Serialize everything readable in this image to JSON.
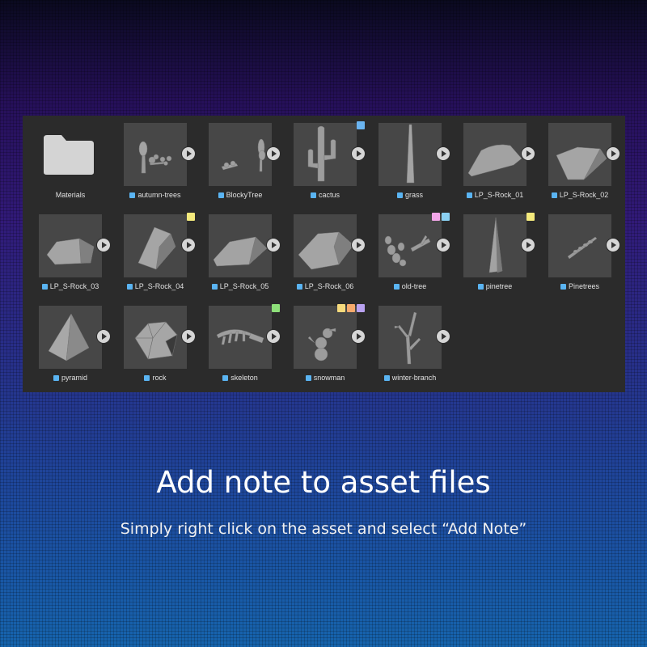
{
  "assets": [
    {
      "label": "Materials",
      "kind": "folder",
      "notes": []
    },
    {
      "label": "autumn-trees",
      "kind": "asset",
      "notes": []
    },
    {
      "label": "BlockyTree",
      "kind": "asset",
      "notes": []
    },
    {
      "label": "cactus",
      "kind": "asset",
      "notes": [
        "#6ab4f0"
      ]
    },
    {
      "label": "grass",
      "kind": "asset",
      "notes": []
    },
    {
      "label": "LP_S-Rock_01",
      "kind": "asset",
      "notes": []
    },
    {
      "label": "LP_S-Rock_02",
      "kind": "asset",
      "notes": []
    },
    {
      "label": "LP_S-Rock_03",
      "kind": "asset",
      "notes": []
    },
    {
      "label": "LP_S-Rock_04",
      "kind": "asset",
      "notes": [
        "#f4ea7c"
      ]
    },
    {
      "label": "LP_S-Rock_05",
      "kind": "asset",
      "notes": []
    },
    {
      "label": "LP_S-Rock_06",
      "kind": "asset",
      "notes": []
    },
    {
      "label": "old-tree",
      "kind": "asset",
      "notes": [
        "#f2a6e8",
        "#8ad0f2"
      ]
    },
    {
      "label": "pinetree",
      "kind": "asset",
      "notes": [
        "#f4ea7c"
      ]
    },
    {
      "label": "Pinetrees",
      "kind": "asset",
      "notes": []
    },
    {
      "label": "pyramid",
      "kind": "asset",
      "notes": []
    },
    {
      "label": "rock",
      "kind": "asset",
      "notes": []
    },
    {
      "label": "skeleton",
      "kind": "asset",
      "notes": [
        "#8ee07a"
      ]
    },
    {
      "label": "snowman",
      "kind": "asset",
      "notes": [
        "#f6da7c",
        "#f6aa6c",
        "#b9a2f0"
      ]
    },
    {
      "label": "winter-branch",
      "kind": "asset",
      "notes": []
    }
  ],
  "caption": {
    "title": "Add note to asset files",
    "subtitle": "Simply right click on the asset and select “Add Note”"
  }
}
